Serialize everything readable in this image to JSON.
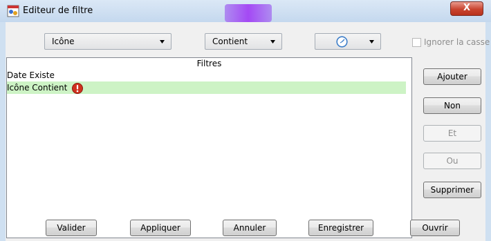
{
  "window": {
    "title": "Editeur de filtre",
    "close_glyph": "X"
  },
  "filter_bar": {
    "field_value": "Icône",
    "operator_value": "Contient",
    "ignore_case_label": "Ignorer la casse"
  },
  "list": {
    "header": "Filtres",
    "rows": [
      {
        "text": "Date Existe"
      },
      {
        "text": "Icône Contient",
        "icon": "error-icon"
      }
    ]
  },
  "side_buttons": {
    "add": "Ajouter",
    "not": "Non",
    "and": "Et",
    "or": "Ou",
    "delete": "Supprimer"
  },
  "bottom_buttons": {
    "validate": "Valider",
    "apply": "Appliquer",
    "cancel": "Annuler",
    "save": "Enregistrer",
    "open": "Ouvrir"
  },
  "colors": {
    "selected_row": "#cdf3c5",
    "error_icon": "#d0311f"
  }
}
